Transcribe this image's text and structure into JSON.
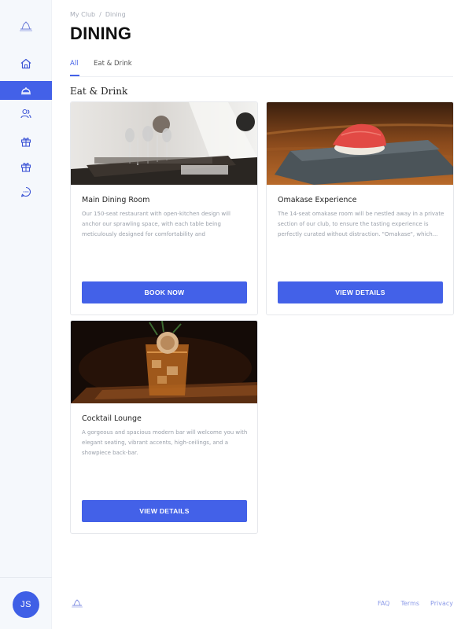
{
  "breadcrumb": {
    "root": "My Club",
    "separator": "/",
    "current": "Dining"
  },
  "page_title": "DINING",
  "tabs": [
    {
      "label": "All",
      "active": true
    },
    {
      "label": "Eat & Drink",
      "active": false
    }
  ],
  "section_title": "Eat & Drink",
  "cards": [
    {
      "title": "Main Dining Room",
      "description": "Our 150-seat restaurant with open-kitchen design will anchor our sprawling space, with each table being meticulously designed for comfortability and unobstructed...",
      "button": "BOOK NOW",
      "image": "dining-room-photo"
    },
    {
      "title": "Omakase Experience",
      "description": "The 14-seat omakase room will be nestled away in a private section of our club, to ensure the tasting experience is perfectly curated without distraction. \"Omakase\", which...",
      "button": "VIEW DETAILS",
      "image": "sushi-photo"
    },
    {
      "title": "Cocktail Lounge",
      "description": "A gorgeous and spacious modern bar will welcome you with elegant seating, vibrant accents, high-ceilings, and a showpiece back-bar.",
      "button": "VIEW DETAILS",
      "image": "cocktail-photo"
    }
  ],
  "sidebar": {
    "items": [
      {
        "icon": "home-icon",
        "active": false
      },
      {
        "icon": "cloche-icon",
        "active": true
      },
      {
        "icon": "people-icon",
        "active": false
      },
      {
        "icon": "gift-icon",
        "active": false
      },
      {
        "icon": "gift-icon",
        "active": false
      },
      {
        "icon": "chat-icon",
        "active": false
      }
    ],
    "avatar_initials": "JS"
  },
  "footer": {
    "links": [
      "FAQ",
      "Terms",
      "Privacy"
    ]
  },
  "colors": {
    "accent": "#4361e8",
    "sidebar_bg": "#f5f8fc"
  }
}
